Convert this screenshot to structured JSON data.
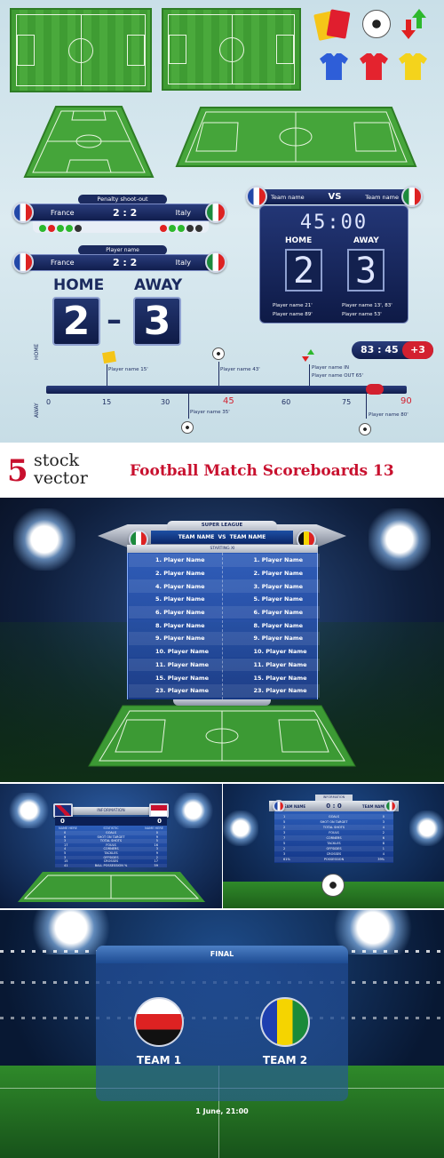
{
  "top": {
    "penalty": {
      "title": "Penalty shoot-out",
      "team_left": "France",
      "score": "2 : 2",
      "team_right": "Italy"
    },
    "card_bar": {
      "title": "Player name",
      "team_left": "France",
      "score": "2 : 2",
      "team_right": "Italy"
    },
    "home_away": {
      "home_label": "HOME",
      "away_label": "AWAY",
      "home_score": "2",
      "dash": "–",
      "away_score": "3"
    },
    "board": {
      "team_left": "Team name",
      "vs": "VS",
      "team_right": "Team name",
      "timer": "45:00",
      "home_label": "HOME",
      "away_label": "AWAY",
      "home_digit": "2",
      "away_digit": "3",
      "scorers_left": [
        "Player name  21'",
        "Player name  89'"
      ],
      "scorers_right": [
        "Player name 13', 83'",
        "Player name 53'"
      ]
    },
    "clock": {
      "time": "83 : 45",
      "added": "+3"
    },
    "timeline": {
      "home_axis": "HOME",
      "away_axis": "AWAY",
      "ticks": [
        "0",
        "15",
        "30",
        "45",
        "60",
        "75",
        "90"
      ],
      "events_home": [
        "Player name 15'",
        "Player name 43'",
        "Player name IN",
        "Player name OUT 65'"
      ],
      "events_away": [
        "Player name 35'",
        "Player name 80'"
      ]
    }
  },
  "banner": {
    "number": "5",
    "word1": "stock",
    "word2": "vector",
    "title": "Football Match Scoreboards 13"
  },
  "lineup": {
    "league": "SUPER LEAGUE",
    "teams": "TEAM NAME  VS  TEAM NAME",
    "subtitle": "STARTING XI",
    "left": [
      "1. Player  Name",
      "2. Player  Name",
      "4. Player  Name",
      "5. Player  Name",
      "6. Player  Name",
      "8. Player  Name",
      "9. Player  Name",
      "10. Player  Name",
      "11. Player  Name",
      "15. Player  Name",
      "23. Player  Name"
    ],
    "right": [
      "1. Player  Name",
      "2. Player  Name",
      "3. Player  Name",
      "5. Player  Name",
      "6. Player  Name",
      "8. Player  Name",
      "9. Player  Name",
      "10. Player  Name",
      "11. Player  Name",
      "15. Player  Name",
      "23. Player  Name"
    ]
  },
  "stats": {
    "header": "INFORMATION",
    "left_score": "0",
    "right_score": "0",
    "col_left": "NAME HERE",
    "col_mid": "STATISTIC",
    "col_right": "NAME HERE",
    "rows": [
      [
        "0",
        "GOALS",
        "0"
      ],
      [
        "6",
        "SHOT ON TARGET",
        "9"
      ],
      [
        "3",
        "TOTAL SHOTS",
        "5"
      ],
      [
        "17",
        "FOULS",
        "16"
      ],
      [
        "4",
        "CORNERS",
        "3"
      ],
      [
        "5",
        "TACKLES",
        "9"
      ],
      [
        "3",
        "OFFSIDES",
        "2"
      ],
      [
        "15",
        "CROSSES",
        "17"
      ],
      [
        "41",
        "BALL POSSESSION %",
        "59"
      ]
    ]
  },
  "stats2": {
    "header": "INFORMATION",
    "team_left": "TEAM NAME",
    "score": "0 : 0",
    "team_right": "TEAM NAME",
    "rows": [
      [
        "1",
        "GOALS",
        "0"
      ],
      [
        "5",
        "SHOT ON TARGET",
        "3"
      ],
      [
        "2",
        "TOTAL SHOTS",
        "4"
      ],
      [
        "3",
        "FOULS",
        "2"
      ],
      [
        "7",
        "CORNERS",
        "6"
      ],
      [
        "5",
        "TACKLES",
        "8"
      ],
      [
        "2",
        "OFFSIDES",
        "1"
      ],
      [
        "3",
        "CROSSES",
        "4"
      ],
      [
        "61%",
        "POSSESSION",
        "39%"
      ]
    ]
  },
  "final": {
    "title": "FINAL",
    "team1": "TEAM 1",
    "team2": "TEAM 2",
    "date": "1 June, 21:00"
  },
  "colors": {
    "navy": "#1b2a5e",
    "red": "#c8102e",
    "pitch": "#3f9c33"
  }
}
